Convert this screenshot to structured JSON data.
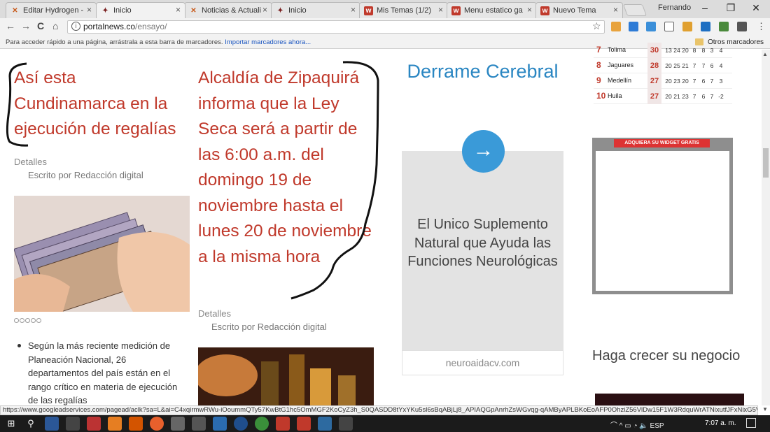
{
  "browser": {
    "tabs": [
      {
        "title": "Editar Hydrogen -",
        "favicon": "hydrogen-icon"
      },
      {
        "title": "Inicio",
        "favicon": "portal-icon",
        "active": true
      },
      {
        "title": "Noticias & Actuali",
        "favicon": "hydrogen-icon"
      },
      {
        "title": "Inicio",
        "favicon": "portal-icon"
      },
      {
        "title": "Mis Temas (1/2)",
        "favicon": "w-icon"
      },
      {
        "title": "Menu estatico ga",
        "favicon": "w-icon"
      },
      {
        "title": "Nuevo Tema",
        "favicon": "w-icon"
      }
    ],
    "close_glyph": "×",
    "user": "Fernando",
    "window_controls": {
      "minimize": "–",
      "restore": "❐",
      "close": "✕"
    },
    "nav": {
      "back": "←",
      "forward": "→",
      "reload": "C",
      "home": "⌂"
    },
    "url": {
      "host": "portalnews.co",
      "path": "/ensayo/"
    },
    "info_glyph": "i",
    "star_glyph": "☆",
    "menu_glyph": "⋮",
    "bookmarks_bar": {
      "text": "Para acceder rápido a una página, arrástrala a esta barra de marcadores.",
      "link": "Importar marcadores ahora...",
      "other": "Otros marcadores"
    },
    "status_url": "https://www.googleadservices.com/pagead/aclk?sa=L&ai=C4xqirmwRWu-iOoummQTy57KwBtG1hc5OmMGF2KoCyZ3h_S0QASDD8tYxYKu5sl6sBqABjLj8_APIAQGpAnrhZsWGvqg-qAMByAPLBKoEoAFP0OhziZ56VlDw15F1W3RdquWrATNixutfJFxNixG5Vss..."
  },
  "page": {
    "article1": {
      "headline": "Así esta Cundinamarca en la ejecución de regalías",
      "detalles": "Detalles",
      "author": "Escrito por Redacción digital",
      "bullet": "Según la más reciente medición de Planeación Nacional, 26 departamentos del país están en el rango crítico en materia de ejecución de las regalías"
    },
    "article2": {
      "headline": "Alcaldía de Zipaquirá informa que la Ley Seca será a partir de las 6:00 a.m. del domingo 19 de noviembre hasta el lunes 20 de noviembre a la misma hora",
      "detalles": "Detalles",
      "author": "Escrito por Redacción digital"
    },
    "ad": {
      "title": "Derrame Cerebral",
      "arrow": "→",
      "body": "El Unico Suplemento Natural que Ayuda las Funciones Neurológicas",
      "domain": "neuroaidacv.com"
    },
    "standings": {
      "rows": [
        {
          "pos": "7",
          "team": "Tolima",
          "pts": "30",
          "stats": [
            "13",
            "24",
            "20",
            "8",
            "8",
            "3",
            "4"
          ]
        },
        {
          "pos": "8",
          "team": "Jaguares",
          "pts": "28",
          "stats": [
            "20",
            "25",
            "21",
            "7",
            "7",
            "6",
            "4"
          ]
        },
        {
          "pos": "9",
          "team": "Medellín",
          "pts": "27",
          "stats": [
            "20",
            "23",
            "20",
            "7",
            "6",
            "7",
            "3"
          ]
        },
        {
          "pos": "10",
          "team": "Huila",
          "pts": "27",
          "stats": [
            "20",
            "21",
            "23",
            "7",
            "6",
            "7",
            "-2"
          ]
        }
      ]
    },
    "widget": {
      "button": "ADQUIERA SU WIDGET GRATIS"
    },
    "sidebar_heading": "Haga crecer su negocio"
  },
  "taskbar": {
    "language": "ESP",
    "clock": "7:07 a. m."
  },
  "colors": {
    "headline": "#c0392b",
    "ad_blue": "#2a86c2",
    "accent_red": "#c0392b"
  }
}
